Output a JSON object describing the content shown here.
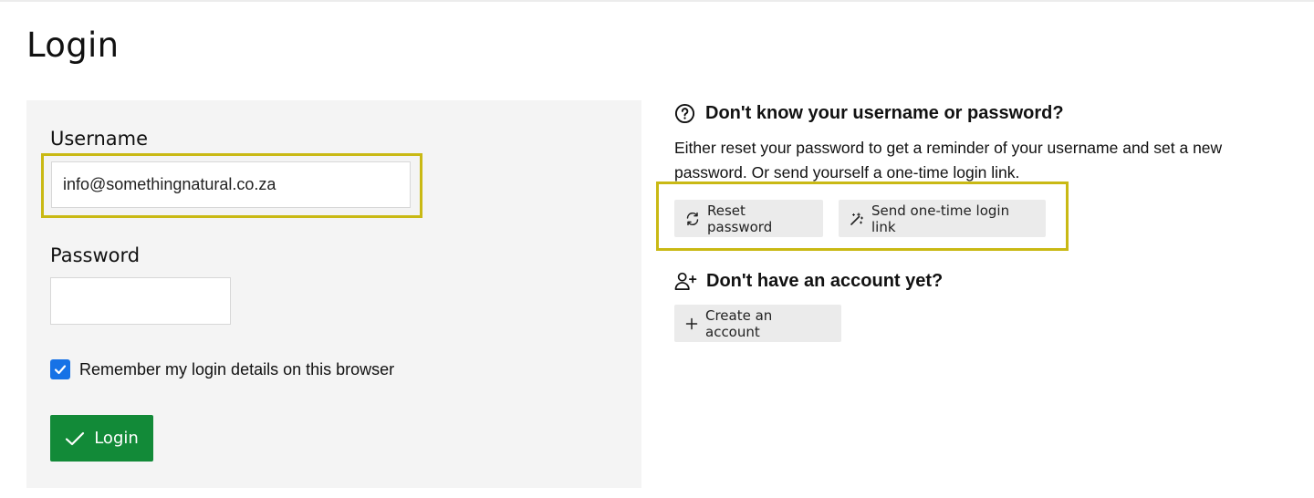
{
  "page": {
    "title": "Login"
  },
  "login_form": {
    "username_label": "Username",
    "username_value": "info@somethingnatural.co.za",
    "password_label": "Password",
    "password_value": "",
    "remember_label": "Remember my login details on this browser",
    "remember_checked": true,
    "login_button_label": "Login"
  },
  "help": {
    "icon": "question-circle-icon",
    "title": "Don't know your username or password?",
    "text": "Either reset your password to get a reminder of your username and set a new password. Or send yourself a one-time login link.",
    "reset_button_label": "Reset password",
    "reset_icon": "refresh-icon",
    "onetime_button_label": "Send one-time login link",
    "onetime_icon": "magic-wand-icon"
  },
  "account": {
    "icon": "user-plus-icon",
    "title": "Don't have an account yet?",
    "create_button_label": "Create an account",
    "create_icon": "plus-icon"
  },
  "colors": {
    "highlight": "#c9b914",
    "login_button": "#128a38",
    "checkbox": "#1672e6",
    "panel_bg": "#f4f4f4",
    "secondary_button_bg": "#ebebeb"
  }
}
